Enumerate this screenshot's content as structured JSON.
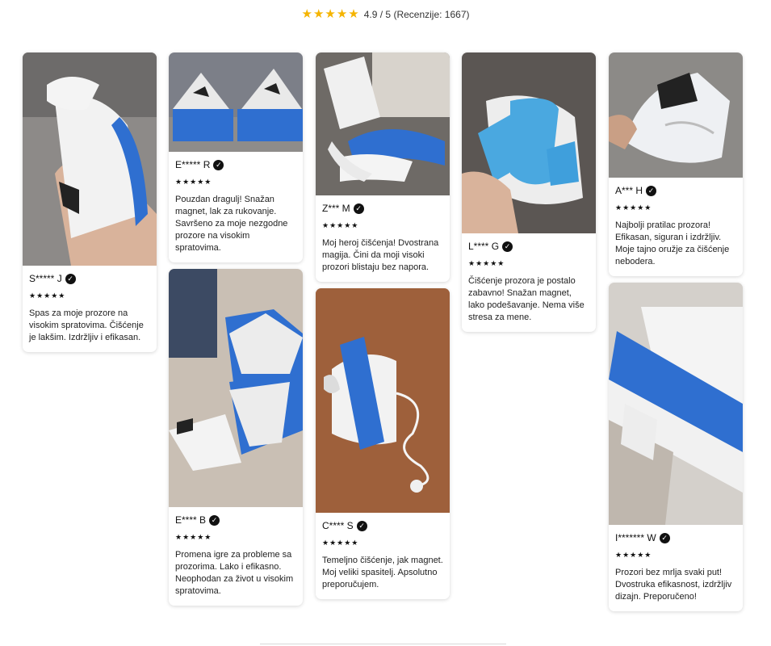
{
  "header": {
    "stars_icon": "five-star-rating",
    "rating_text": "4.9 / 5 (Recenzije: 1667)",
    "star_color": "#f5b400"
  },
  "reviews": [
    {
      "author": "S***** J",
      "stars": "★★★★★",
      "text": "Spas za moje prozore na visokim spratovima. Čišćenje je lakšim. Izdržljiv i efikasan."
    },
    {
      "author": "E***** R",
      "stars": "★★★★★",
      "text": "Pouzdan dragulj! Snažan magnet, lak za rukovanje. Savršeno za moje nezgodne prozore na visokim spratovima."
    },
    {
      "author": "E**** B",
      "stars": "★★★★★",
      "text": "Promena igre za probleme sa prozorima. Lako i efikasno. Neophodan za život u visokim spratovima."
    },
    {
      "author": "Z*** M",
      "stars": "★★★★★",
      "text": "Moj heroj čišćenja! Dvostrana magija. Čini da moji visoki prozori blistaju bez napora."
    },
    {
      "author": "C**** S",
      "stars": "★★★★★",
      "text": "Temeljno čišćenje, jak magnet. Moj veliki spasitelj. Apsolutno preporučujem."
    },
    {
      "author": "L**** G",
      "stars": "★★★★★",
      "text": "Čišćenje prozora je postalo zabavno! Snažan magnet, lako podešavanje. Nema više stresa za mene."
    },
    {
      "author": "A*** H",
      "stars": "★★★★★",
      "text": "Najbolji pratilac prozora! Efikasan, siguran i izdržljiv. Moje tajno oružje za čišćenje nebodera."
    },
    {
      "author": "I******* W",
      "stars": "★★★★★",
      "text": "Prozori bez mrlja svaki put! Dvostruka efikasnost, izdržljiv dizajn. Preporučeno!"
    }
  ]
}
